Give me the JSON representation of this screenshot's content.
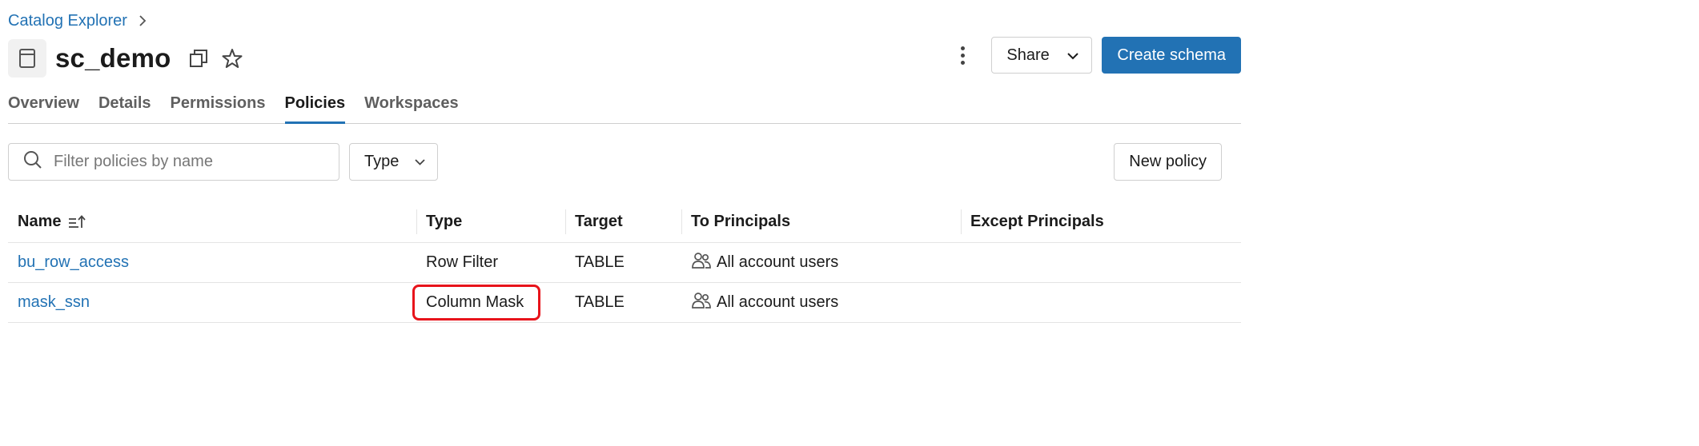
{
  "breadcrumb": {
    "root": "Catalog Explorer"
  },
  "header": {
    "title": "sc_demo",
    "share_label": "Share",
    "create_label": "Create schema"
  },
  "tabs": [
    {
      "label": "Overview",
      "active": false
    },
    {
      "label": "Details",
      "active": false
    },
    {
      "label": "Permissions",
      "active": false
    },
    {
      "label": "Policies",
      "active": true
    },
    {
      "label": "Workspaces",
      "active": false
    }
  ],
  "filters": {
    "search_placeholder": "Filter policies by name",
    "type_label": "Type",
    "new_policy_label": "New policy"
  },
  "table": {
    "columns": [
      "Name",
      "Type",
      "Target",
      "To Principals",
      "Except Principals"
    ],
    "rows": [
      {
        "name": "bu_row_access",
        "type": "Row Filter",
        "target": "TABLE",
        "to_principals": "All account users",
        "except_principals": ""
      },
      {
        "name": "mask_ssn",
        "type": "Column Mask",
        "target": "TABLE",
        "to_principals": "All account users",
        "except_principals": ""
      }
    ]
  },
  "colors": {
    "accent": "#2272b4",
    "highlight": "#e8141b"
  },
  "icons": [
    "schema-icon",
    "copy-icon",
    "star-icon",
    "kebab-menu-icon",
    "chevron-down-icon",
    "search-icon",
    "sort-ascending-icon",
    "users-icon",
    "chevron-right-icon"
  ]
}
